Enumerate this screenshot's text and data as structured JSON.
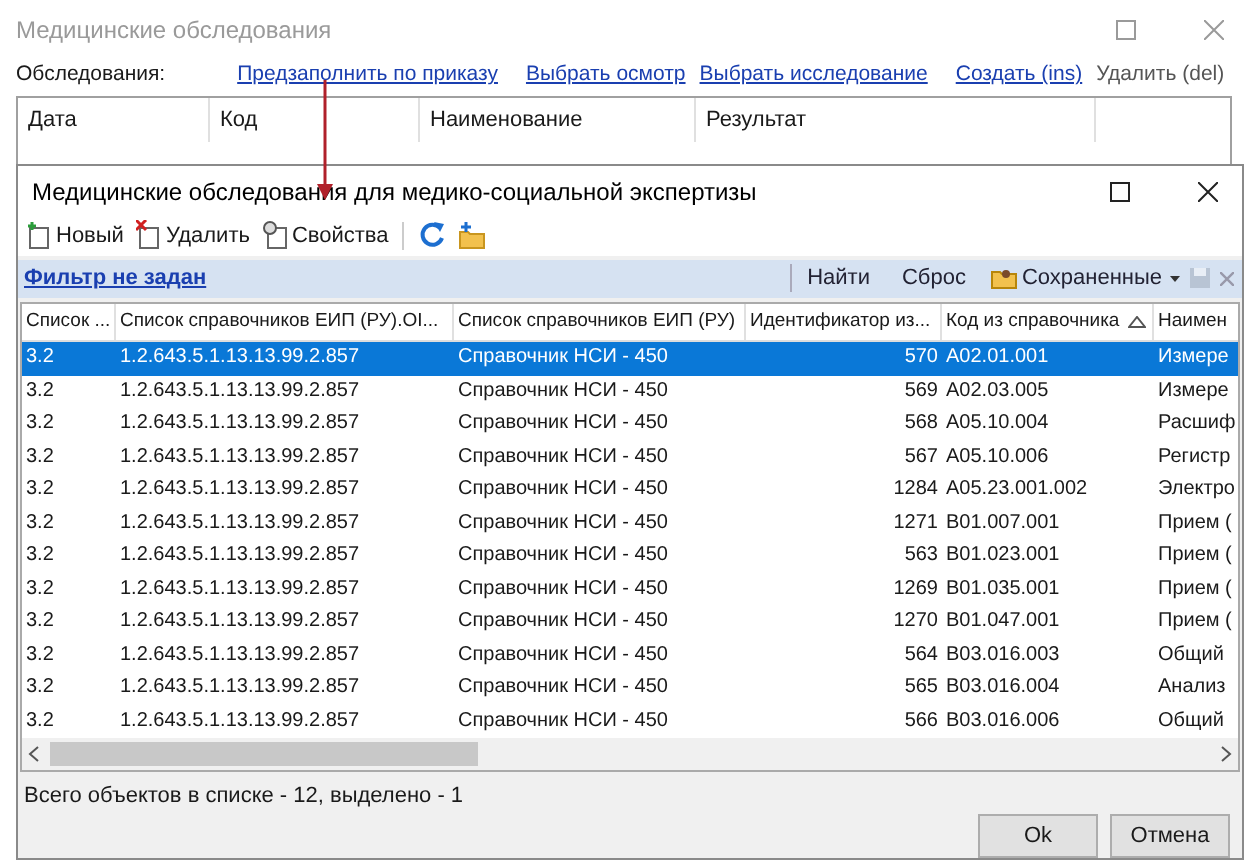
{
  "back_window": {
    "title": "Медицинские обследования",
    "section_label": "Обследования:",
    "links": [
      {
        "label": "Предзаполнить по приказу",
        "disabled": false
      },
      {
        "label": "Выбрать осмотр",
        "disabled": false
      },
      {
        "label": "Выбрать исследование",
        "disabled": false
      },
      {
        "label": "Создать (ins)",
        "disabled": false
      },
      {
        "label": "Удалить (del)",
        "disabled": true
      }
    ],
    "columns": [
      "Дата",
      "Код",
      "Наименование",
      "Результат"
    ]
  },
  "dialog": {
    "title": "Медицинские обследования для медико-социальной экспертизы",
    "toolbar": [
      {
        "kind": "new",
        "label": "Новый"
      },
      {
        "kind": "delete",
        "label": "Удалить"
      },
      {
        "kind": "properties",
        "label": "Свойства"
      },
      {
        "kind": "refresh"
      },
      {
        "kind": "folder"
      }
    ],
    "filter": {
      "label": "Фильтр не задан",
      "buttons": [
        "Найти",
        "Сброс"
      ],
      "saved": "Сохраненные"
    },
    "columns": [
      {
        "label": "Список ...",
        "sorted_ascending": false
      },
      {
        "label": "Список справочников ЕИП (РУ).OI...",
        "sorted_ascending": false
      },
      {
        "label": "Список справочников ЕИП (РУ)",
        "sorted_ascending": false
      },
      {
        "label": "Идентификатор из...",
        "sorted_ascending": false
      },
      {
        "label": "Код из справочника",
        "sorted_ascending": true
      },
      {
        "label": "Наимен",
        "sorted_ascending": false
      }
    ],
    "rows": [
      {
        "selected": true,
        "cells": [
          "3.2",
          "1.2.643.5.1.13.13.99.2.857",
          "Справочник НСИ - 450",
          "570",
          "A02.01.001",
          "Измере"
        ]
      },
      {
        "selected": false,
        "cells": [
          "3.2",
          "1.2.643.5.1.13.13.99.2.857",
          "Справочник НСИ - 450",
          "569",
          "A02.03.005",
          "Измере"
        ]
      },
      {
        "selected": false,
        "cells": [
          "3.2",
          "1.2.643.5.1.13.13.99.2.857",
          "Справочник НСИ - 450",
          "568",
          "A05.10.004",
          "Расшиф"
        ]
      },
      {
        "selected": false,
        "cells": [
          "3.2",
          "1.2.643.5.1.13.13.99.2.857",
          "Справочник НСИ - 450",
          "567",
          "A05.10.006",
          "Регистр"
        ]
      },
      {
        "selected": false,
        "cells": [
          "3.2",
          "1.2.643.5.1.13.13.99.2.857",
          "Справочник НСИ - 450",
          "1284",
          "A05.23.001.002",
          "Электро"
        ]
      },
      {
        "selected": false,
        "cells": [
          "3.2",
          "1.2.643.5.1.13.13.99.2.857",
          "Справочник НСИ - 450",
          "1271",
          "B01.007.001",
          "Прием ("
        ]
      },
      {
        "selected": false,
        "cells": [
          "3.2",
          "1.2.643.5.1.13.13.99.2.857",
          "Справочник НСИ - 450",
          "563",
          "B01.023.001",
          "Прием ("
        ]
      },
      {
        "selected": false,
        "cells": [
          "3.2",
          "1.2.643.5.1.13.13.99.2.857",
          "Справочник НСИ - 450",
          "1269",
          "B01.035.001",
          "Прием ("
        ]
      },
      {
        "selected": false,
        "cells": [
          "3.2",
          "1.2.643.5.1.13.13.99.2.857",
          "Справочник НСИ - 450",
          "1270",
          "B01.047.001",
          "Прием ("
        ]
      },
      {
        "selected": false,
        "cells": [
          "3.2",
          "1.2.643.5.1.13.13.99.2.857",
          "Справочник НСИ - 450",
          "564",
          "B03.016.003",
          "Общий"
        ]
      },
      {
        "selected": false,
        "cells": [
          "3.2",
          "1.2.643.5.1.13.13.99.2.857",
          "Справочник НСИ - 450",
          "565",
          "B03.016.004",
          "Анализ"
        ]
      },
      {
        "selected": false,
        "cells": [
          "3.2",
          "1.2.643.5.1.13.13.99.2.857",
          "Справочник НСИ - 450",
          "566",
          "B03.016.006",
          "Общий"
        ]
      }
    ],
    "status": "Всего объектов в списке - 12, выделено - 1",
    "buttons": [
      "Ok",
      "Отмена"
    ]
  }
}
